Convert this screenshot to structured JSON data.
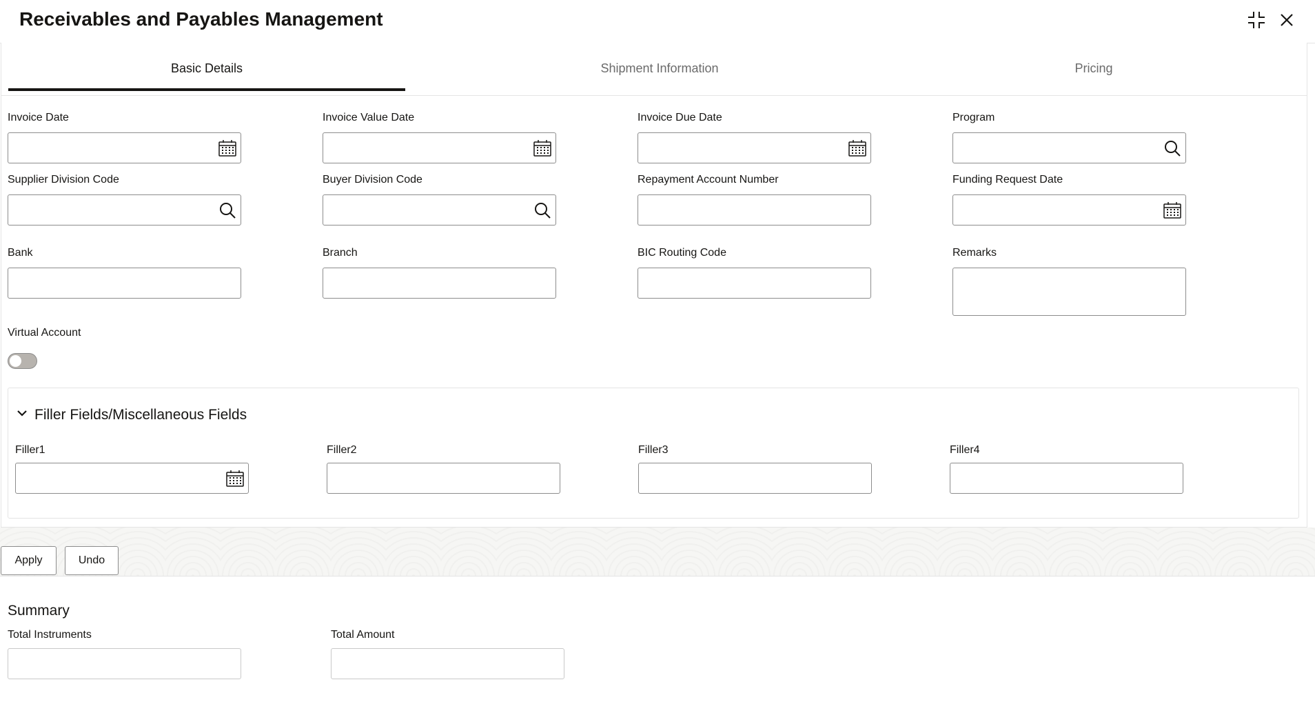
{
  "header": {
    "title": "Receivables and Payables Management"
  },
  "tabs": [
    {
      "label": "Basic Details",
      "active": true
    },
    {
      "label": "Shipment Information",
      "active": false
    },
    {
      "label": "Pricing",
      "active": false
    }
  ],
  "fields": {
    "invoice_date": {
      "label": "Invoice Date",
      "value": "",
      "icon": "calendar-icon"
    },
    "invoice_value_date": {
      "label": "Invoice Value Date",
      "value": "",
      "icon": "calendar-icon"
    },
    "invoice_due_date": {
      "label": "Invoice Due Date",
      "value": "",
      "icon": "calendar-icon"
    },
    "program": {
      "label": "Program",
      "value": "",
      "icon": "search-icon"
    },
    "supplier_division_code": {
      "label": "Supplier Division Code",
      "value": "",
      "icon": "search-icon"
    },
    "buyer_division_code": {
      "label": "Buyer Division Code",
      "value": "",
      "icon": "search-icon"
    },
    "repayment_account_number": {
      "label": "Repayment Account Number",
      "value": ""
    },
    "funding_request_date": {
      "label": "Funding Request Date",
      "value": "",
      "icon": "calendar-icon"
    },
    "bank": {
      "label": "Bank",
      "value": ""
    },
    "branch": {
      "label": "Branch",
      "value": ""
    },
    "bic_routing_code": {
      "label": "BIC Routing Code",
      "value": ""
    },
    "remarks": {
      "label": "Remarks",
      "value": ""
    },
    "virtual_account": {
      "label": "Virtual Account",
      "enabled": false
    }
  },
  "filler_section": {
    "title": "Filler Fields/Miscellaneous Fields",
    "expanded": true,
    "filler1": {
      "label": "Filler1",
      "value": "",
      "icon": "calendar-icon"
    },
    "filler2": {
      "label": "Filler2",
      "value": ""
    },
    "filler3": {
      "label": "Filler3",
      "value": ""
    },
    "filler4": {
      "label": "Filler4",
      "value": ""
    }
  },
  "actions": {
    "apply_label": "Apply",
    "undo_label": "Undo"
  },
  "summary": {
    "title": "Summary",
    "total_instruments": {
      "label": "Total Instruments",
      "value": ""
    },
    "total_amount": {
      "label": "Total Amount",
      "value": ""
    }
  },
  "colors": {
    "text": "#161513",
    "border": "#8c8c8c",
    "muted_tab": "#6b6b6b",
    "toggle_off": "#b7b3ae"
  }
}
